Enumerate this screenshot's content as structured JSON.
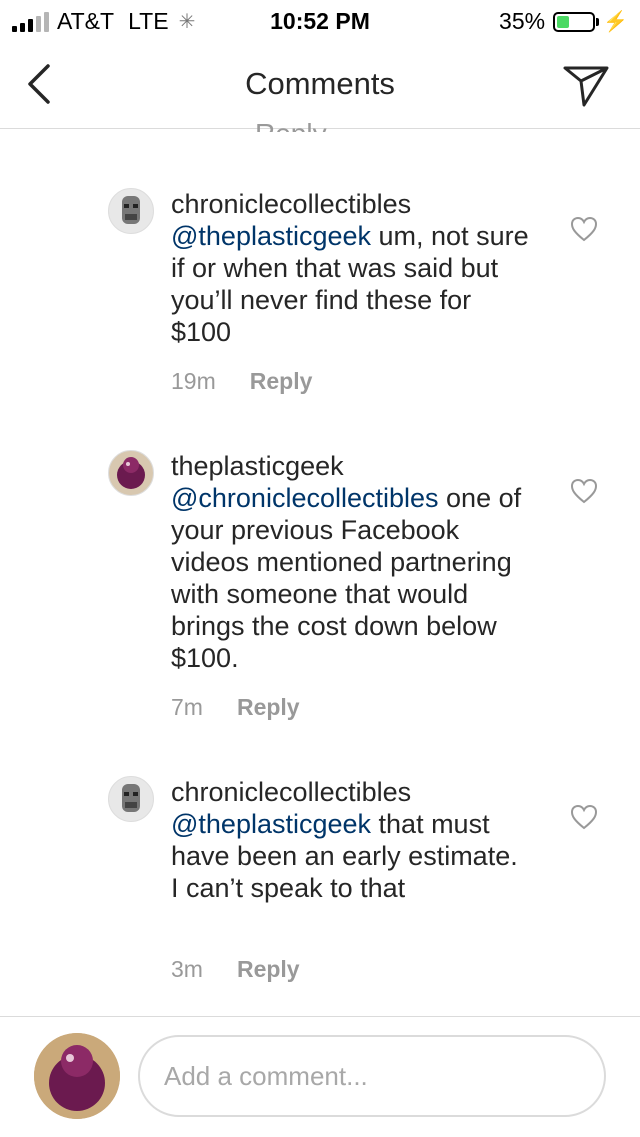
{
  "status_bar": {
    "carrier": "AT&T",
    "network": "LTE",
    "time": "10:52 PM",
    "battery_percent": "35%",
    "battery_level": 0.35,
    "icons": [
      "signal-icon",
      "loading-spinner-icon",
      "battery-icon",
      "charging-bolt-icon"
    ]
  },
  "nav": {
    "title": "Comments",
    "icons": [
      "back-chevron-icon",
      "send-direct-icon"
    ]
  },
  "partial_row_text": "Reply",
  "comments": [
    {
      "username": "chroniclecollectibles",
      "mention": "@theplasticgeek",
      "text": " um, not sure if or when that was said but you’ll never find these for $100",
      "time": "19m",
      "reply_label": "Reply"
    },
    {
      "username": "theplasticgeek",
      "mention": "@chroniclecollectibles",
      "text": " one of your previous Facebook videos mentioned partnering with someone that would brings the cost down below $100.",
      "time": "7m",
      "reply_label": "Reply"
    },
    {
      "username": "chroniclecollectibles",
      "mention": "@theplasticgeek",
      "text": " that must have been an early estimate.  I can’t speak to that",
      "time": "3m",
      "reply_label": "Reply"
    }
  ],
  "composer": {
    "placeholder": "Add a comment..."
  },
  "colors": {
    "mention": "#003569",
    "text": "#262626",
    "secondary": "#999999",
    "divider": "#dbdbdb",
    "battery_fill": "#4cd964"
  }
}
